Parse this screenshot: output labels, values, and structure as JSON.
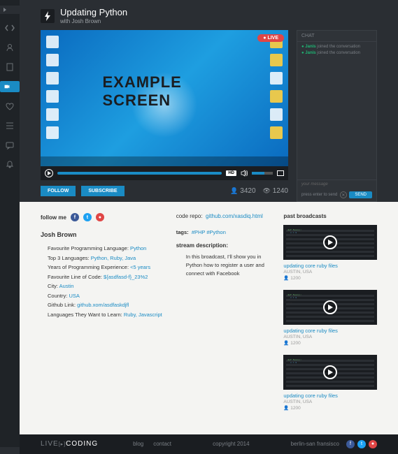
{
  "header": {
    "title": "Updating Python",
    "with_prefix": "with ",
    "author": "Josh Brown"
  },
  "video": {
    "overlay_text": "EXAMPLE SCREEN",
    "live_badge": "● LIVE",
    "hd": "HD"
  },
  "actions": {
    "follow": "FOLLOW",
    "subscribe": "SUBSCRIBE"
  },
  "stats": {
    "viewers": "3420",
    "favorites": "1240"
  },
  "chat": {
    "header": "CHAT",
    "lines": [
      {
        "name": "Janis",
        "text": "joined the conversation"
      },
      {
        "name": "Janis",
        "text": "joined the conversation"
      }
    ],
    "placeholder": "your message",
    "hint": "press enter to send",
    "send": "SEND"
  },
  "profile": {
    "follow_label": "follow me",
    "name": "Josh Brown",
    "items": [
      {
        "label": "Favourite Programming Language: ",
        "value": "Python"
      },
      {
        "label": "Top 3 Languages: ",
        "value": "Python, Ruby, Java"
      },
      {
        "label": "Years of Programming Experience: ",
        "value": "<5 years"
      },
      {
        "label": "Favourite Line of Code: ",
        "value": "${asdfasd-f}_23%2"
      },
      {
        "label": "City: ",
        "value": "Austin"
      },
      {
        "label": "Country: ",
        "value": "USA"
      },
      {
        "label": "Github Link: ",
        "value": "github.xom/asdfaskdjfl"
      },
      {
        "label": "Languages They Want to Learn: ",
        "value": "Ruby, Javascript"
      }
    ]
  },
  "repo": {
    "label": "code repo:",
    "link": "github.com/xasdiq.html"
  },
  "tags": {
    "label": "tags:",
    "values": "#PHP #Python"
  },
  "description": {
    "label": "stream description:",
    "text": "In this broadcast, I'll show you in Python how to register a user and connect with Facebook"
  },
  "past": {
    "label": "past broadcasts",
    "items": [
      {
        "title": "updating core ruby files",
        "location": "AUSTIN, USA",
        "views": "1200"
      },
      {
        "title": "updating core ruby files",
        "location": "AUSTIN, USA",
        "views": "1200"
      },
      {
        "title": "updating core ruby files",
        "location": "AUSTIN, USA",
        "views": "1200"
      }
    ]
  },
  "footer": {
    "logo_a": "LIVE",
    "logo_b": "CODING",
    "links": {
      "blog": "blog",
      "contact": "contact"
    },
    "copyright": "copyright 2014",
    "location": "berlin-san fransisco"
  }
}
